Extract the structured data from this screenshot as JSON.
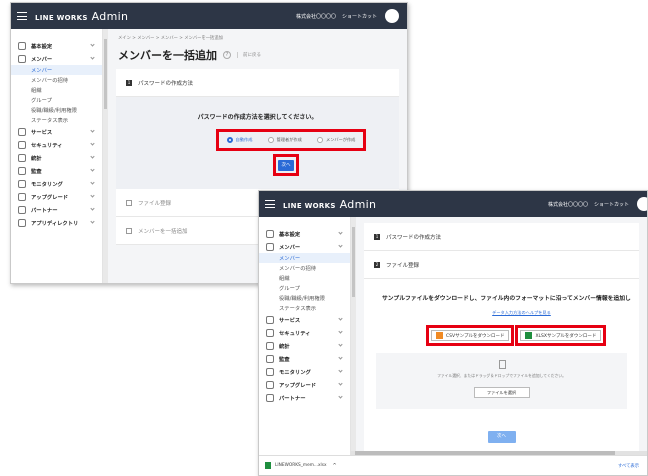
{
  "brand": "LINE WORKS",
  "brand_admin": "Admin",
  "company": "株式会社〇〇〇〇",
  "shortcut": "ショートカット",
  "sidebar_items": [
    {
      "label": "基本設定",
      "type": "head"
    },
    {
      "label": "メンバー",
      "type": "head"
    },
    {
      "label": "メンバー",
      "type": "sub",
      "active": true
    },
    {
      "label": "メンバーの招待",
      "type": "sub"
    },
    {
      "label": "組織",
      "type": "sub"
    },
    {
      "label": "グループ",
      "type": "sub"
    },
    {
      "label": "役職/職級/利用権限",
      "type": "sub"
    },
    {
      "label": "ステータス表示",
      "type": "sub"
    },
    {
      "label": "サービス",
      "type": "head"
    },
    {
      "label": "セキュリティ",
      "type": "head"
    },
    {
      "label": "統計",
      "type": "head"
    },
    {
      "label": "監査",
      "type": "head"
    },
    {
      "label": "モニタリング",
      "type": "head"
    },
    {
      "label": "アップグレード",
      "type": "head"
    },
    {
      "label": "パートナー",
      "type": "head"
    },
    {
      "label": "アプリディレクトリ",
      "type": "head"
    }
  ],
  "window1": {
    "breadcrumb": "メイン > メンバー > メンバー > メンバーを一括追加",
    "title": "メンバーを一括追加",
    "back": "前に戻る",
    "step1": "パスワードの作成方法",
    "prompt": "パスワードの作成方法を選択してください。",
    "radio_options": [
      "自動作成",
      "管理者が作成",
      "メンバーが作成"
    ],
    "next": "次へ",
    "step2": "ファイル登録",
    "step3": "メンバーを一括追加"
  },
  "window2": {
    "step1": "パスワードの作成方法",
    "step2": "ファイル登録",
    "prompt": "サンプルファイルをダウンロードし、ファイル内のフォーマットに沿ってメンバー情報を追加し",
    "help_link": "データ入力方法のヘルプを見る",
    "csv_button": "CSVサンプルをダウンロード",
    "xlsx_button": "XLSXサンプルをダウンロード",
    "drop_text": "ファイル選択、またはドラッグ＆ドロップでファイルを追加してください。",
    "select_file": "ファイルを選択",
    "next": "次へ",
    "download_file": "LINEWORKS_mem...xlsx",
    "show_all": "すべて表示"
  },
  "colors": {
    "topbar": "#2d3646",
    "accent": "#2a6ad6",
    "highlight": "#e60012"
  }
}
